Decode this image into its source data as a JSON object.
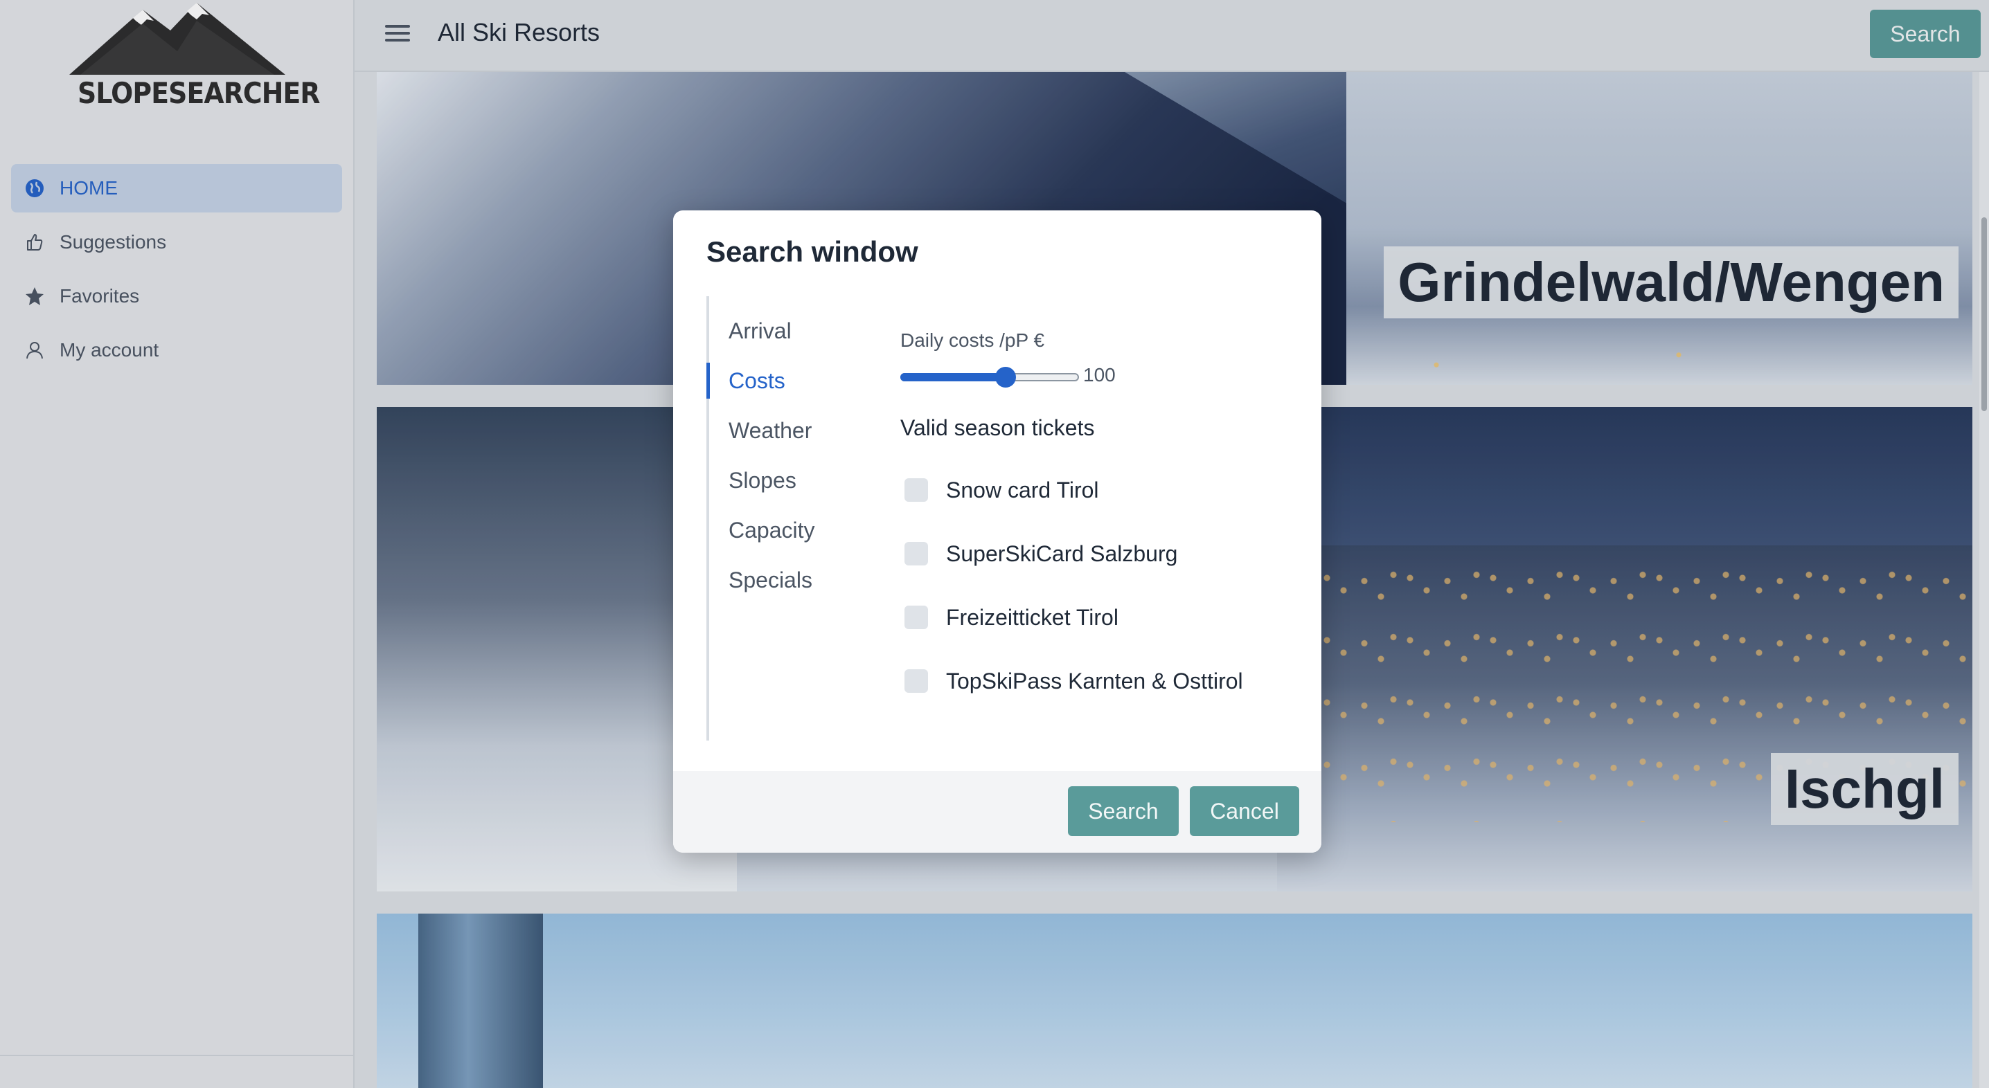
{
  "app": {
    "logo_text": "SLOPESEARCHER",
    "page_title": "All Ski Resorts",
    "header_search_label": "Search"
  },
  "sidebar": {
    "items": [
      {
        "label": "HOME",
        "icon": "globe-icon",
        "active": true
      },
      {
        "label": "Suggestions",
        "icon": "thumbs-up-icon",
        "active": false
      },
      {
        "label": "Favorites",
        "icon": "star-icon",
        "active": false
      },
      {
        "label": "My account",
        "icon": "user-icon",
        "active": false
      }
    ]
  },
  "resorts": [
    {
      "name": "Grindelwald/Wengen"
    },
    {
      "name": "Ischgl"
    },
    {
      "name": ""
    }
  ],
  "modal": {
    "title": "Search window",
    "tabs": [
      "Arrival",
      "Costs",
      "Weather",
      "Slopes",
      "Capacity",
      "Specials"
    ],
    "active_tab": "Costs",
    "daily_costs_label": "Daily costs /pP €",
    "slider": {
      "value": "100",
      "fraction": 0.59
    },
    "season_tickets_label": "Valid season tickets",
    "season_tickets": [
      {
        "label": "Snow card Tirol",
        "checked": false
      },
      {
        "label": "SuperSkiCard Salzburg",
        "checked": false
      },
      {
        "label": "Freizeitticket Tirol",
        "checked": false
      },
      {
        "label": "TopSkiPass Karnten & Osttirol",
        "checked": false
      }
    ],
    "search_label": "Search",
    "cancel_label": "Cancel"
  },
  "colors": {
    "accent": "#2563c9",
    "button": "#5a9b9a",
    "sidebar_active": "#c5d3e6"
  }
}
